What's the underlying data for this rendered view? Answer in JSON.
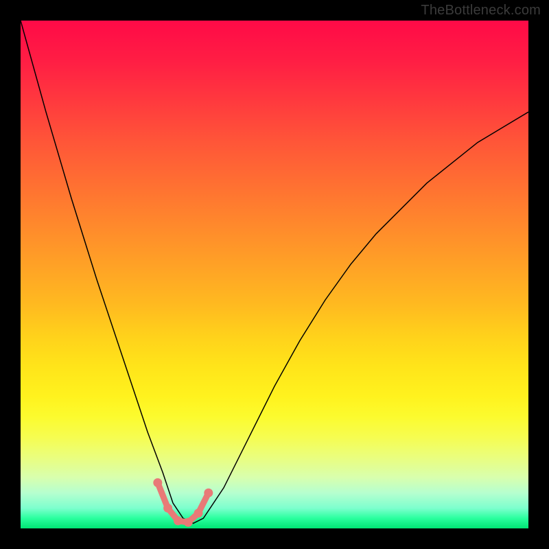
{
  "watermark": "TheBottleneck.com",
  "chart_data": {
    "type": "line",
    "title": "",
    "xlabel": "",
    "ylabel": "",
    "xlim": [
      0,
      100
    ],
    "ylim": [
      0,
      100
    ],
    "grid": false,
    "legend": false,
    "series": [
      {
        "name": "bottleneck-curve",
        "x": [
          0,
          5,
          10,
          15,
          20,
          25,
          28,
          30,
          32,
          34,
          36,
          40,
          45,
          50,
          55,
          60,
          65,
          70,
          75,
          80,
          85,
          90,
          95,
          100
        ],
        "y": [
          100,
          82,
          65,
          49,
          34,
          19,
          11,
          5,
          2,
          1,
          2,
          8,
          18,
          28,
          37,
          45,
          52,
          58,
          63,
          68,
          72,
          76,
          79,
          82
        ]
      }
    ],
    "markers": {
      "name": "highlight-band",
      "x": [
        27,
        29,
        31,
        33,
        35,
        37
      ],
      "y": [
        9,
        4,
        1.5,
        1.2,
        3,
        7
      ]
    },
    "background_gradient": {
      "top": "#ff0a47",
      "mid": "#ffe41a",
      "bottom": "#00e574"
    }
  }
}
